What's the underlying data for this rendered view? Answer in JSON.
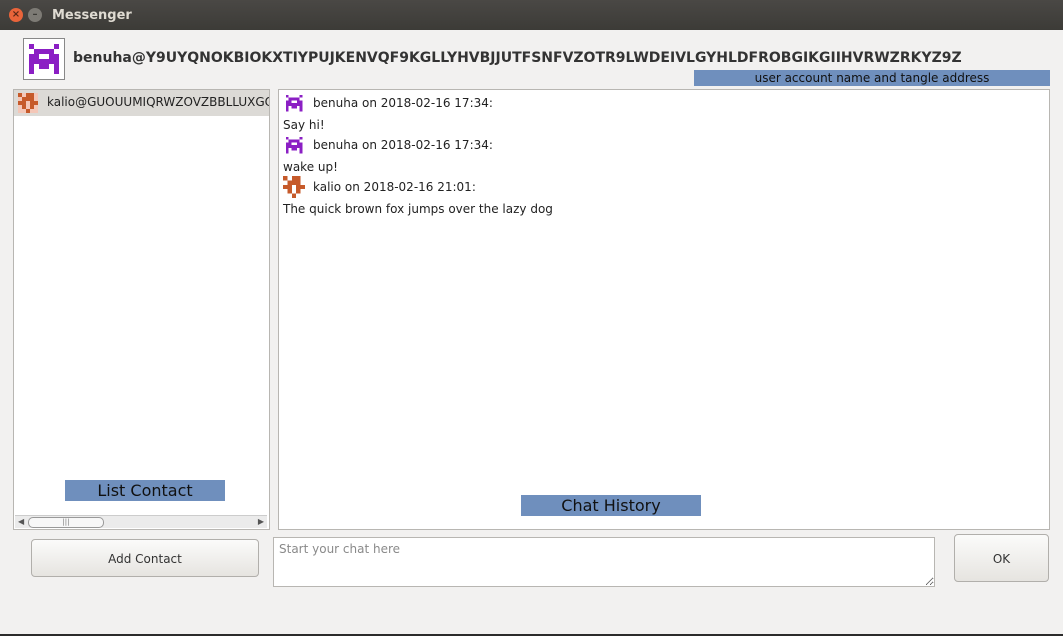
{
  "window": {
    "title": "Messenger"
  },
  "header": {
    "account": "benuha@Y9UYQNOKBIOKXTIYPUJKENVQF9KGLLYHVBJJUTFSNFVZOTR9LWDEIVLGYHLDFROBGIKGIIHVRWZRKYZ9Z",
    "avatar_icon": "purple-pixel-avatar-icon",
    "annotation": "user account name and tangle address"
  },
  "contacts": {
    "items": [
      {
        "label": "kalio@GUOUUMIQRWZOVZBBLLUXGO",
        "avatar_icon": "orange-pixel-avatar-icon"
      }
    ],
    "annotation": "List Contact",
    "scroll_grip": "|||"
  },
  "chat": {
    "messages": [
      {
        "sender_line": "benuha on 2018-02-16 17:34:",
        "text": "Say hi!",
        "avatar_icon": "purple-pixel-avatar-icon"
      },
      {
        "sender_line": "benuha on 2018-02-16 17:34:",
        "text": "wake up!",
        "avatar_icon": "purple-pixel-avatar-icon"
      },
      {
        "sender_line": "kalio on 2018-02-16 21:01:",
        "text": "The quick brown fox jumps over the lazy dog",
        "avatar_icon": "orange-pixel-avatar-icon"
      }
    ],
    "annotation": "Chat History",
    "input_placeholder": "Start your chat here",
    "input_value": ""
  },
  "buttons": {
    "add_contact": "Add Contact",
    "ok": "OK"
  },
  "colors": {
    "purple_avatar": "#8b1fc4",
    "orange_avatar": "#c65a2a",
    "annotation_bg": "#6f8fbd",
    "titlebar": "#3c3b37"
  }
}
